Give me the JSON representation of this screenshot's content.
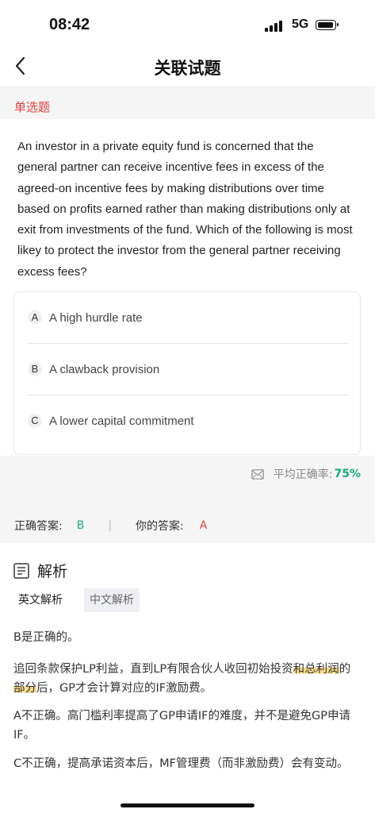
{
  "status_bar": {
    "time": "08:42",
    "network": "5G"
  },
  "nav": {
    "title": "关联试题"
  },
  "question": {
    "type": "单选题",
    "text": "An investor in a private equity fund is concerned that the general partner can receive incentive fees in excess of the agreed-on incentive fees by making distributions over time based on profits earned rather than making distributions only at exit from investments of the fund. Which of the following is most likey to protect the investor from the general partner receiving excess fees?",
    "options": [
      {
        "letter": "A",
        "text": "A high hurdle rate"
      },
      {
        "letter": "B",
        "text": "A clawback provision"
      },
      {
        "letter": "C",
        "text": "A lower capital commitment"
      }
    ]
  },
  "stats": {
    "accuracy_label": "平均正确率:",
    "accuracy_value": "75%"
  },
  "answers": {
    "correct_label": "正确答案:",
    "correct_value": "B",
    "divider": "|",
    "yours_label": "你的答案:",
    "yours_value": "A"
  },
  "explanation": {
    "title": "解析",
    "tabs": [
      "英文解析",
      "中文解析"
    ],
    "p1": "B是正确的。",
    "p2_part1": "追回条款保护LP利益，直到LP有限合伙人收回初始投资",
    "p2_hl1": "和总利润",
    "p2_part2": "的",
    "p2_hl2": "部分",
    "p2_part3": "后，GP才会计算对应的IF激励费。",
    "p3": "A不正确。高门槛利率提高了GP申请IF的难度，并不是避免GP申请IF。",
    "p4": "C不正确，提高承诺资本后，MF管理费（而非激励费）会有变动。"
  },
  "colors": {
    "red": "#e0413d",
    "green": "#1aaa79",
    "highlight": "#f8dc8a"
  },
  "icons": [
    "signal-icon",
    "battery-icon",
    "back-chevron-icon",
    "mail-icon",
    "document-icon"
  ]
}
